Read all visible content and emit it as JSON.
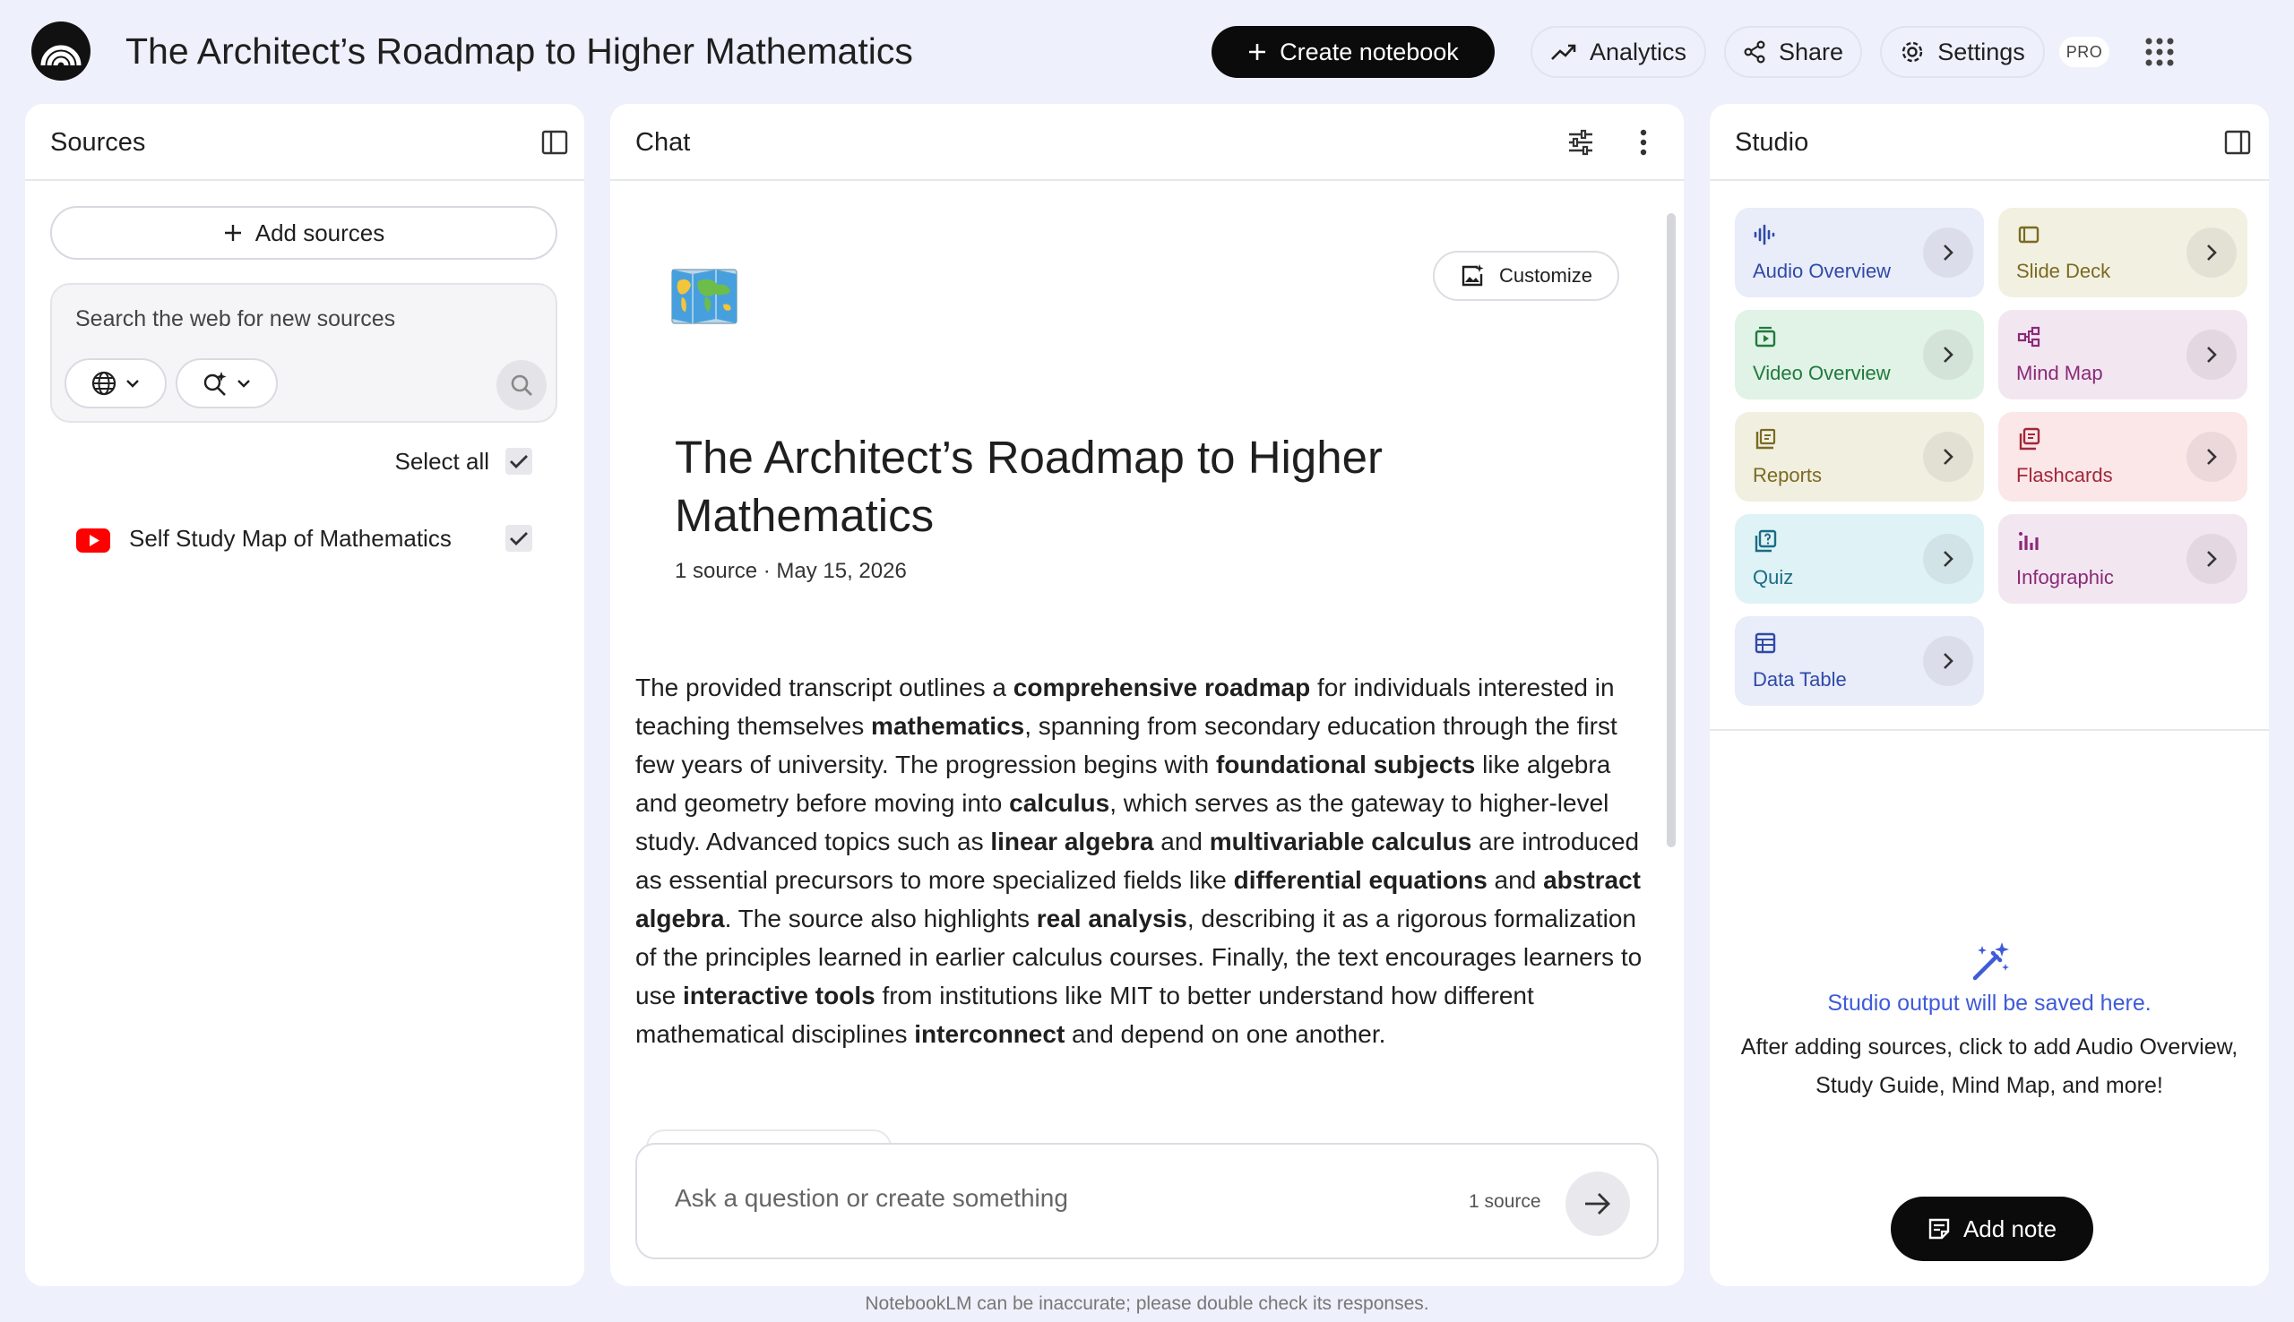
{
  "header": {
    "title": "The Architect’s Roadmap to Higher Mathematics",
    "create_label": "Create notebook",
    "analytics_label": "Analytics",
    "share_label": "Share",
    "settings_label": "Settings",
    "pro_badge": "PRO"
  },
  "sources": {
    "title": "Sources",
    "add_label": "Add sources",
    "search_placeholder": "Search the web for new sources",
    "select_all_label": "Select all",
    "items": [
      {
        "label": "Self Study Map of Mathematics",
        "icon": "youtube-icon",
        "checked": true
      }
    ]
  },
  "chat": {
    "title": "Chat",
    "customize_label": "Customize",
    "notebook_title": "The Architect’s Roadmap to Higher Mathematics",
    "meta": "1 source · May 15, 2026",
    "summary": [
      {
        "t": "The provided transcript outlines a ",
        "b": false
      },
      {
        "t": "comprehensive roadmap",
        "b": true
      },
      {
        "t": " for individuals interested in teaching themselves ",
        "b": false
      },
      {
        "t": "mathematics",
        "b": true
      },
      {
        "t": ", spanning from secondary education through the first few years of university. The progression begins with ",
        "b": false
      },
      {
        "t": "foundational subjects",
        "b": true
      },
      {
        "t": " like algebra and geometry before moving into ",
        "b": false
      },
      {
        "t": "calculus",
        "b": true
      },
      {
        "t": ", which serves as the gateway to higher-level study. Advanced topics such as ",
        "b": false
      },
      {
        "t": "linear algebra",
        "b": true
      },
      {
        "t": " and ",
        "b": false
      },
      {
        "t": "multivariable calculus",
        "b": true
      },
      {
        "t": " are introduced as essential precursors to more specialized fields like ",
        "b": false
      },
      {
        "t": "differential equations",
        "b": true
      },
      {
        "t": " and ",
        "b": false
      },
      {
        "t": "abstract algebra",
        "b": true
      },
      {
        "t": ". The source also highlights ",
        "b": false
      },
      {
        "t": "real analysis",
        "b": true
      },
      {
        "t": ", describing it as a rigorous formalization of the principles learned in earlier calculus courses. Finally, the text encourages learners to use ",
        "b": false
      },
      {
        "t": "interactive tools",
        "b": true
      },
      {
        "t": " from institutions like MIT to better understand how different mathematical disciplines ",
        "b": false
      },
      {
        "t": "interconnect",
        "b": true
      },
      {
        "t": " and depend on one another.",
        "b": false
      }
    ],
    "input_placeholder": "Ask a question or create something",
    "source_count": "1 source"
  },
  "studio": {
    "title": "Studio",
    "tiles": [
      {
        "label": "Audio Overview",
        "icon": "audio-waveform-icon",
        "bg": "#e9ecf9",
        "fg": "#2f4aa8"
      },
      {
        "label": "Slide Deck",
        "icon": "slides-icon",
        "bg": "#f2f0e1",
        "fg": "#7a6a22"
      },
      {
        "label": "Video Overview",
        "icon": "video-icon",
        "bg": "#e1f2e6",
        "fg": "#1f7a3c"
      },
      {
        "label": "Mind Map",
        "icon": "mind-map-icon",
        "bg": "#f2e6f0",
        "fg": "#8a2a78"
      },
      {
        "label": "Reports",
        "icon": "reports-icon",
        "bg": "#f1efe0",
        "fg": "#7a6a22"
      },
      {
        "label": "Flashcards",
        "icon": "flashcards-icon",
        "bg": "#fbe6e8",
        "fg": "#a0283a"
      },
      {
        "label": "Quiz",
        "icon": "quiz-icon",
        "bg": "#dff2f6",
        "fg": "#1a6d85"
      },
      {
        "label": "Infographic",
        "icon": "infographic-icon",
        "bg": "#f2e6f0",
        "fg": "#8a2a78"
      },
      {
        "label": "Data Table",
        "icon": "table-icon",
        "bg": "#e9ecf9",
        "fg": "#2f4aa8"
      }
    ],
    "empty_title": "Studio output will be saved here.",
    "empty_text": "After adding sources, click to add Audio Overview, Study Guide, Mind Map, and more!",
    "add_note_label": "Add note"
  },
  "footer": "NotebookLM can be inaccurate; please double check its responses."
}
